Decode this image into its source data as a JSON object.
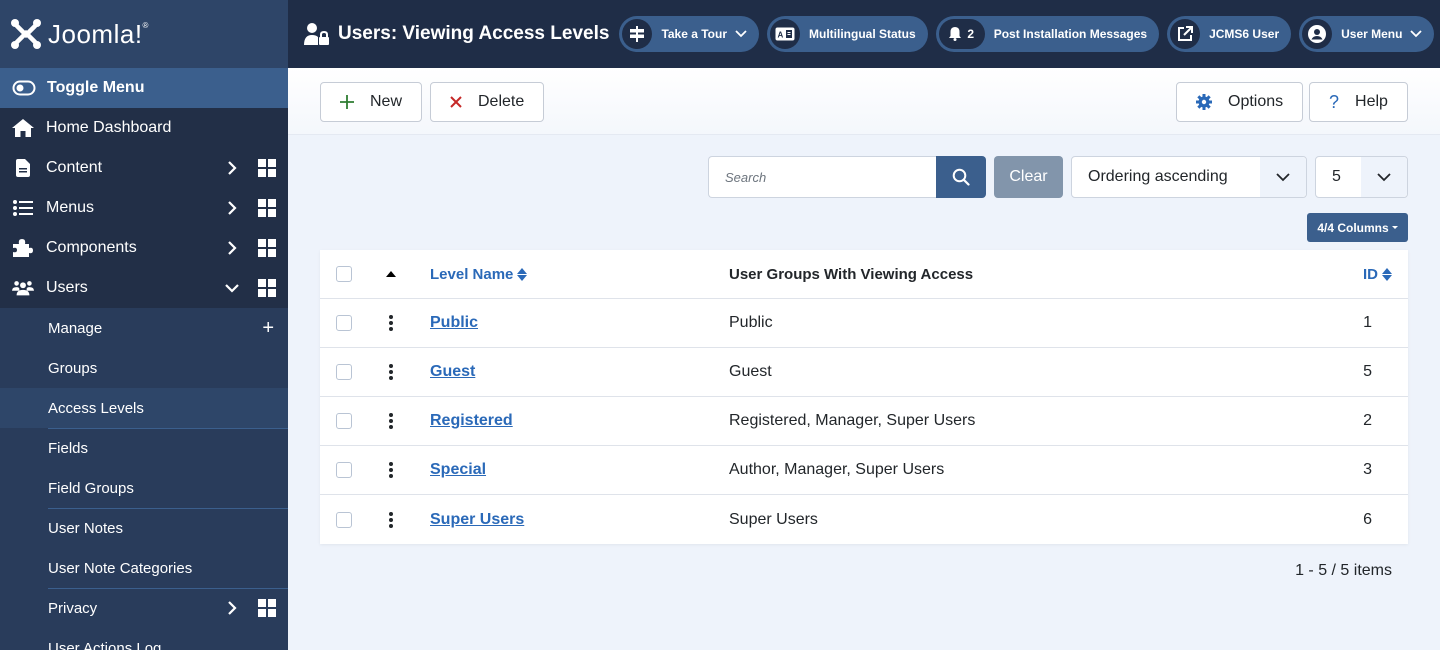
{
  "brand": {
    "name": "Joomla!",
    "mark": "®"
  },
  "sidebar": {
    "toggle_label": "Toggle Menu",
    "items": [
      {
        "label": "Home Dashboard",
        "icon": "home-icon"
      },
      {
        "label": "Content",
        "icon": "file-icon"
      },
      {
        "label": "Menus",
        "icon": "list-icon"
      },
      {
        "label": "Components",
        "icon": "puzzle-icon"
      },
      {
        "label": "Users",
        "icon": "users-icon"
      }
    ],
    "users_submenu": [
      {
        "label": "Manage"
      },
      {
        "label": "Groups"
      },
      {
        "label": "Access Levels",
        "active": true
      },
      {
        "label": "Fields"
      },
      {
        "label": "Field Groups"
      },
      {
        "label": "User Notes"
      },
      {
        "label": "User Note Categories"
      },
      {
        "label": "Privacy"
      },
      {
        "label": "User Actions Log"
      }
    ]
  },
  "header": {
    "title": "Users: Viewing Access Levels",
    "take_tour": "Take a Tour",
    "multilingual": "Multilingual Status",
    "post_install_count": "2",
    "post_install": "Post Installation Messages",
    "site_link": "JCMS6 User",
    "user_menu": "User Menu"
  },
  "toolbar": {
    "new_label": "New",
    "delete_label": "Delete",
    "options_label": "Options",
    "help_label": "Help"
  },
  "filters": {
    "search_placeholder": "Search",
    "search_value": "",
    "clear_label": "Clear",
    "ordering_value": "Ordering ascending",
    "limit_value": "5",
    "columns_label": "4/4 Columns"
  },
  "table": {
    "headers": {
      "level_name": "Level Name",
      "groups": "User Groups With Viewing Access",
      "id": "ID"
    },
    "rows": [
      {
        "name": "Public",
        "groups": "Public",
        "id": "1"
      },
      {
        "name": "Guest",
        "groups": "Guest",
        "id": "5"
      },
      {
        "name": "Registered",
        "groups": "Registered, Manager, Super Users",
        "id": "2"
      },
      {
        "name": "Special",
        "groups": "Author, Manager, Super Users",
        "id": "3"
      },
      {
        "name": "Super Users",
        "groups": "Super Users",
        "id": "6"
      }
    ]
  },
  "pagination": {
    "summary": "1 - 5 / 5 items"
  },
  "colors": {
    "sidebar_bg": "#222f47",
    "header_bg": "#1f2d47",
    "accent": "#3b5f8d",
    "link": "#2a69b8",
    "new_icon": "#2f7d32",
    "delete_icon": "#c52827"
  }
}
